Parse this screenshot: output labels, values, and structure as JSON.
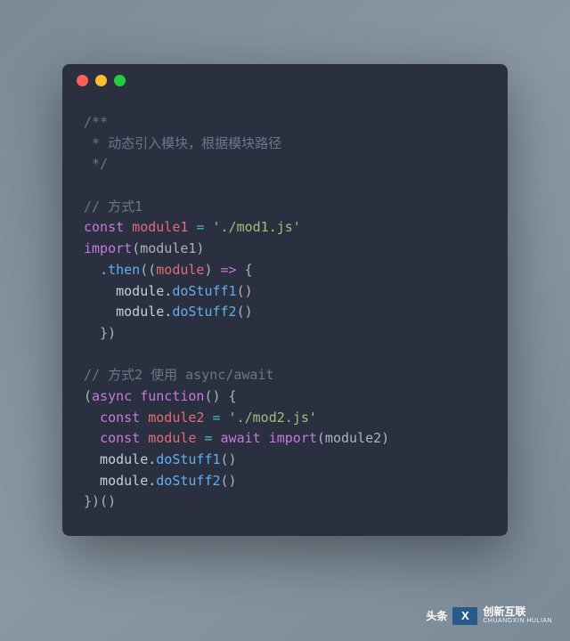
{
  "code": {
    "block_comment_open": "/**",
    "block_comment_line": " * 动态引入模块，根据模块路径",
    "block_comment_close": " */",
    "blank": "",
    "comment_way1": "// 方式1",
    "l1_const": "const",
    "l1_var": " module1 ",
    "l1_eq": "=",
    "l1_str": " './mod1.js'",
    "l2_import": "import",
    "l2_args": "(module1)",
    "l3_indent": "  ",
    "l3_dot": ".",
    "l3_then": "then",
    "l3_open": "((",
    "l3_param": "module",
    "l3_close": ") ",
    "l3_arrow": "=>",
    "l3_brace": " {",
    "l4": "    module.",
    "l4_fn": "doStuff1",
    "l4_call": "()",
    "l5": "    module.",
    "l5_fn": "doStuff2",
    "l5_call": "()",
    "l6": "  })",
    "comment_way2": "// 方式2 使用 async/await",
    "l7_open": "(",
    "l7_async": "async",
    "l7_sp": " ",
    "l7_function": "function",
    "l7_rest": "() {",
    "l8_indent": "  ",
    "l8_const": "const",
    "l8_var": " module2 ",
    "l8_eq": "=",
    "l8_str": " './mod2.js'",
    "l9_indent": "  ",
    "l9_const": "const",
    "l9_var": " module ",
    "l9_eq": "=",
    "l9_sp": " ",
    "l9_await": "await",
    "l9_sp2": " ",
    "l9_import": "import",
    "l9_args": "(module2)",
    "l10": "  module.",
    "l10_fn": "doStuff1",
    "l10_call": "()",
    "l11": "  module.",
    "l11_fn": "doStuff2",
    "l11_call": "()",
    "l12": "})()"
  },
  "watermark": {
    "prefix": "头条",
    "logo": "X",
    "brand": "创新互联",
    "sub": "CHUANGXIN HULIAN"
  }
}
